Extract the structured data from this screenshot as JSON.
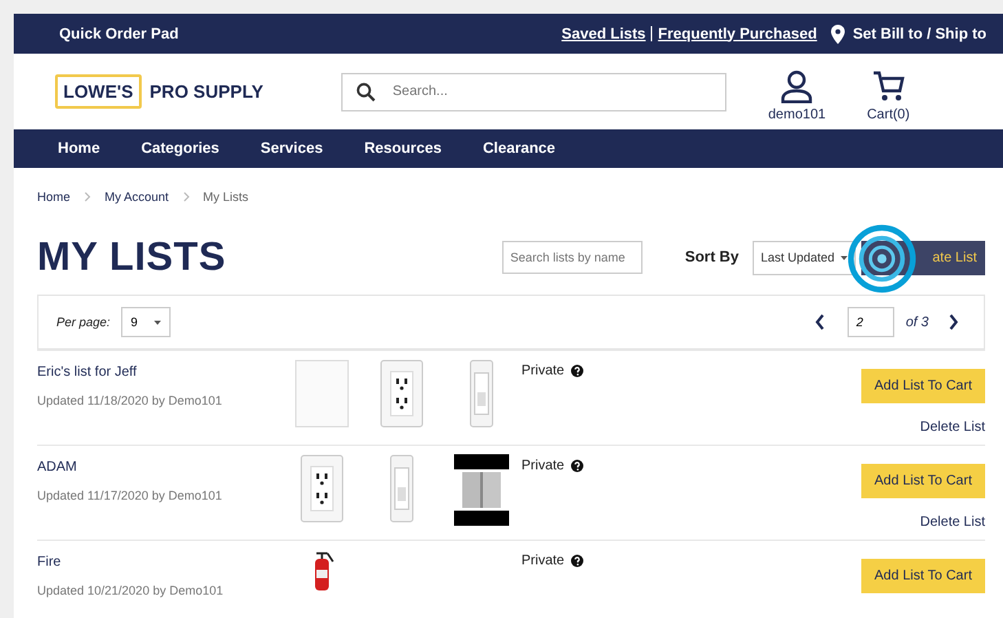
{
  "utility_bar": {
    "quick_order": "Quick Order Pad",
    "links": [
      "Saved Lists",
      "Frequently Purchased"
    ],
    "location": "Set Bill to / Ship to"
  },
  "header": {
    "logo": {
      "brand": "LOWE'S",
      "suffix": "PRO SUPPLY"
    },
    "search": {
      "placeholder": "Search..."
    },
    "account": "demo101",
    "cart": "Cart(0)"
  },
  "nav": [
    "Home",
    "Categories",
    "Services",
    "Resources",
    "Clearance"
  ],
  "breadcrumb": [
    {
      "label": "Home",
      "current": false
    },
    {
      "label": "My Account",
      "current": false
    },
    {
      "label": "My Lists",
      "current": true
    }
  ],
  "page_title": "MY LISTS",
  "list_search": {
    "placeholder": "Search lists by name"
  },
  "sort": {
    "label": "Sort By",
    "value": "Last Updated"
  },
  "create_button": "ate List",
  "pagination": {
    "per_page_label": "Per page:",
    "per_page": "9",
    "page": "2",
    "of": "of 3"
  },
  "lists": [
    {
      "name": "Eric's list for Jeff",
      "updated": "Updated 11/18/2020 by Demo101",
      "items": [
        {
          "kind": "plate"
        },
        {
          "kind": "outlet"
        },
        {
          "kind": "switch"
        }
      ],
      "privacy": "Private",
      "add_button": "Add List To Cart",
      "delete": "Delete List"
    },
    {
      "name": "ADAM",
      "updated": "Updated 11/17/2020 by Demo101",
      "items": [
        {
          "kind": "outlet"
        },
        {
          "kind": "switch"
        },
        {
          "kind": "hinge"
        }
      ],
      "privacy": "Private",
      "add_button": "Add List To Cart",
      "delete": "Delete List"
    },
    {
      "name": "Fire",
      "updated": "Updated 10/21/2020 by Demo101",
      "items": [
        {
          "kind": "extinguisher"
        }
      ],
      "privacy": "Private",
      "add_button": "Add List To Cart"
    }
  ]
}
